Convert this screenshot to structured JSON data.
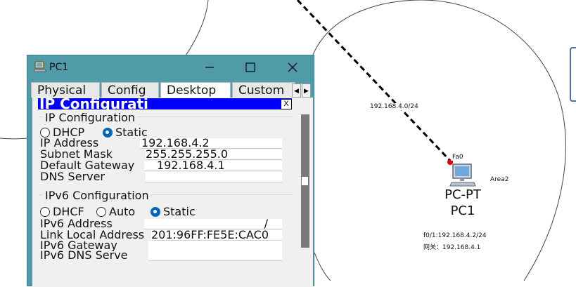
{
  "topology": {
    "link_label": "192.168.4.0/24",
    "port_label": "Fa0",
    "area_label": "Area2",
    "device_type": "PC-PT",
    "device_name": "PC1",
    "info_line1": "f0/1:192.168.4.2/24",
    "info_line2": "网关：192.168.4.1"
  },
  "window": {
    "title": "PC1",
    "minimize_icon": "minimize-icon",
    "maximize_icon": "maximize-icon",
    "close_icon": "close-icon",
    "tabs": [
      "Physical",
      "Config",
      "Desktop",
      "Custom"
    ],
    "active_tab": "Desktop"
  },
  "ip_config": {
    "header": "IP Configurati",
    "close_label": "X",
    "ipv4_group": "IP Configuration",
    "dhcp_label": "DHCP",
    "static_label": "Static",
    "mode": "Static",
    "ip_address_label": "IP Address",
    "ip_address": "192.168.4.2",
    "subnet_mask_label": "Subnet Mask",
    "subnet_mask": "255.255.255.0",
    "default_gateway_label": "Default Gateway",
    "default_gateway": "192.168.4.1",
    "dns_server_label": "DNS Server",
    "dns_server": "",
    "ipv6_group": "IPv6 Configuration",
    "ipv6_dhcp_label": "DHCF",
    "ipv6_auto_label": "Auto",
    "ipv6_static_label": "Static",
    "ipv6_mode": "Static",
    "ipv6_address_label": "IPv6 Address",
    "ipv6_address": "/",
    "link_local_label": "Link Local Address",
    "link_local": "201:96FF:FE5E:CAC0",
    "ipv6_gateway_label": "IPv6 Gateway",
    "ipv6_gateway": "",
    "ipv6_dns_label": "IPv6 DNS Serve",
    "ipv6_dns": ""
  },
  "colors": {
    "window_frame": "#4f9ba8",
    "header_bar": "#0000ff",
    "radio_selected": "#0067c0",
    "link_dot": "#e00000"
  }
}
